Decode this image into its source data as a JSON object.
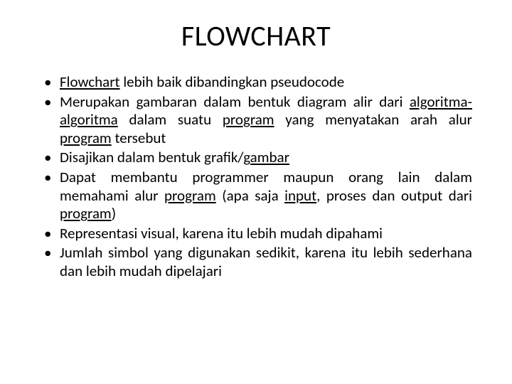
{
  "title": "FLOWCHART",
  "bullets": {
    "b0": {
      "t0": "Flowchart",
      "t1": " lebih baik dibandingkan pseudocode"
    },
    "b1": {
      "t0": "Merupakan gambaran dalam bentuk diagram alir dari ",
      "t1": "algoritma-algoritma",
      "t2": " dalam suatu ",
      "t3": "program",
      "t4": " yang menyatakan arah alur ",
      "t5": "program",
      "t6": " tersebut"
    },
    "b2": {
      "t0": "Disajikan dalam bentuk grafik/",
      "t1": "gambar"
    },
    "b3": {
      "t0": "Dapat membantu programmer maupun orang lain dalam memahami alur ",
      "t1": "program",
      "t2": " (apa saja ",
      "t3": "input",
      "t4": ", proses dan output dari ",
      "t5": "program",
      "t6": ")"
    },
    "b4": {
      "t0": "Representasi visual, karena itu lebih mudah dipahami"
    },
    "b5": {
      "t0": "Jumlah simbol yang digunakan sedikit, karena itu lebih sederhana dan lebih mudah dipelajari"
    }
  }
}
